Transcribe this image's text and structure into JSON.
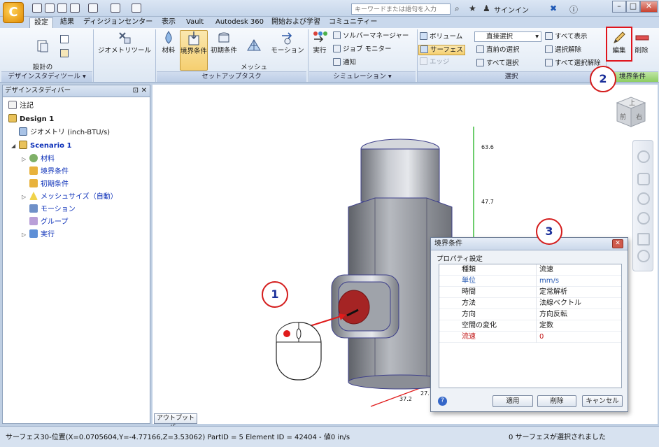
{
  "title_bar": {
    "search_placeholder": "キーワードまたは語句を入力",
    "signin": "サインイン"
  },
  "tabs": [
    "設定",
    "結果",
    "ディシジョンセンター",
    "表示",
    "Vault",
    "Autodesk 360",
    "開始および学習",
    "コミュニティー"
  ],
  "ribbon": {
    "design_study": {
      "add_update": "設計の\n追加/更新",
      "panel": "デザインスタディツール ▾"
    },
    "geometry_tools": "ジオメトリツール",
    "setup": {
      "material": "材料",
      "boundary": "境界条件",
      "initial": "初期条件",
      "mesh": "メッシュ\nサイズ",
      "motion": "モーション",
      "panel": "セットアップタスク"
    },
    "simulation": {
      "run": "実行",
      "solver": "ソルバーマネージャー",
      "job_monitor": "ジョブ モニター",
      "notify": "通知",
      "panel": "シミュレーション ▾"
    },
    "select": {
      "volume": "ボリューム",
      "surface": "サーフェス",
      "edge": "エッジ",
      "dropdown": "直接選択",
      "previous": "直前の選択",
      "select_all": "すべて選択",
      "show_all": "すべて表示",
      "deselect": "選択解除",
      "deselect_all": "すべて選択解除",
      "panel": "選択"
    },
    "boundary_conditions": {
      "edit": "編集",
      "delete": "削除",
      "panel": "境界条件"
    }
  },
  "design_study_bar": {
    "title": "デザインスタディバー",
    "items": [
      {
        "label": "注記"
      },
      {
        "label": "Design 1"
      },
      {
        "label": "ジオメトリ (inch-BTU/s)"
      },
      {
        "label": "Scenario 1"
      },
      {
        "label": "材料"
      },
      {
        "label": "境界条件"
      },
      {
        "label": "初期条件"
      },
      {
        "label": "メッシュサイズ（自動）"
      },
      {
        "label": "モーション"
      },
      {
        "label": "グループ"
      },
      {
        "label": "実行"
      }
    ]
  },
  "viewport": {
    "view_cube": {
      "top": "上",
      "front": "前",
      "right": "右"
    },
    "axis_labels": [
      "63.6",
      "47.7",
      "37.2",
      "27."
    ],
    "output_bar": "アウトプットバー"
  },
  "dialog": {
    "title": "境界条件",
    "group": "プロパティ設定",
    "properties": [
      {
        "name": "種類",
        "value": "流速"
      },
      {
        "name": "単位",
        "value": "mm/s"
      },
      {
        "name": "時間",
        "value": "定常解析"
      },
      {
        "name": "方法",
        "value": "法線ベクトル"
      },
      {
        "name": "方向",
        "value": "方向反転"
      },
      {
        "name": "空間の変化",
        "value": "定数"
      },
      {
        "name": "流速",
        "value": "0"
      }
    ],
    "apply": "適用",
    "delete": "削除",
    "cancel": "キャンセル"
  },
  "callouts": [
    "1",
    "2",
    "3"
  ],
  "status": {
    "left": "サーフェス30-位置(X=0.0705604,Y=-4.77166,Z=3.53062) PartID = 5 Element ID = 42404 - 値0  in/s",
    "right": "0 サーフェスが選択されました"
  },
  "colors": {
    "accent_red": "#d41c1c",
    "tree_blue": "#0b2fb8",
    "pressed": "#f5cf70"
  }
}
